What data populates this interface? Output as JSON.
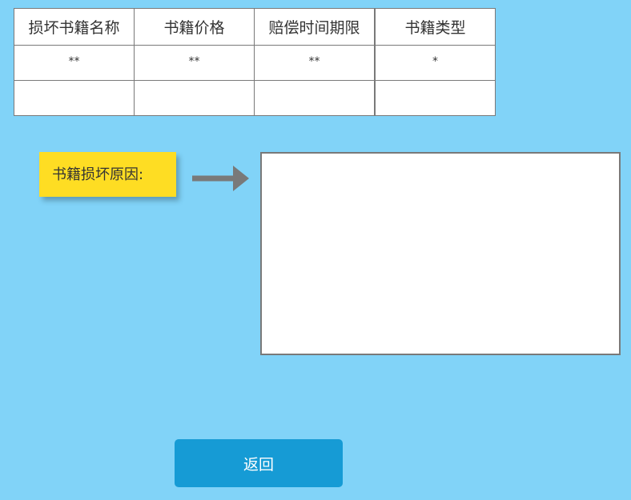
{
  "table": {
    "headers": [
      "损坏书籍名称",
      "书籍价格",
      "赔偿时间期限",
      "书籍类型"
    ],
    "rows": [
      [
        "**",
        "**",
        "**",
        "*"
      ],
      [
        "",
        "",
        "",
        ""
      ]
    ]
  },
  "reason": {
    "label": "书籍损坏原因:",
    "value": ""
  },
  "arrow_icon": "arrow-right-icon",
  "back_button": {
    "label": "返回"
  },
  "colors": {
    "background": "#81d3f8",
    "label_bg": "#fedd23",
    "button_bg": "#169bd5",
    "border": "#797979",
    "arrow": "#797979"
  }
}
